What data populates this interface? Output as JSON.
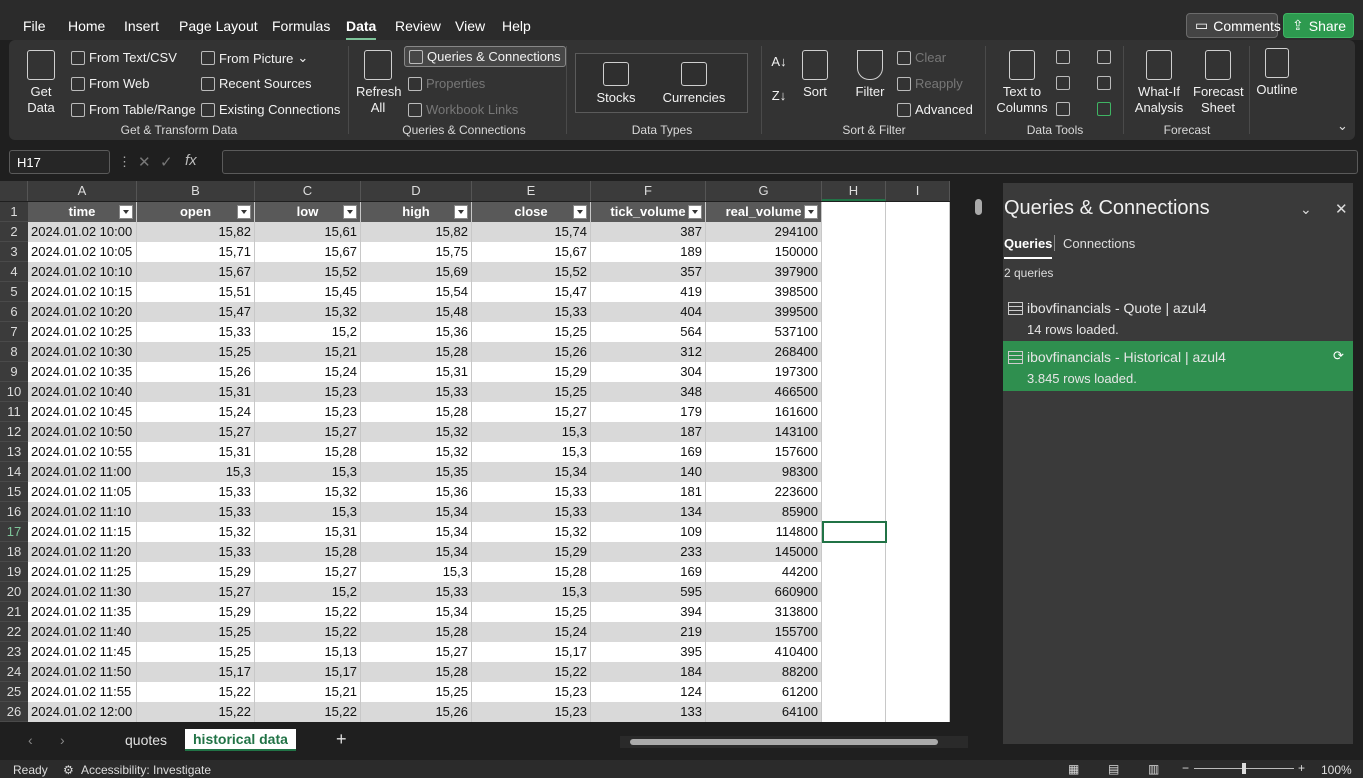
{
  "menu": [
    "File",
    "Home",
    "Insert",
    "Page Layout",
    "Formulas",
    "Data",
    "Review",
    "View",
    "Help"
  ],
  "menu_active": "Data",
  "top_buttons": {
    "comments": "Comments",
    "share": "Share"
  },
  "ribbon": {
    "get_data": [
      "Get",
      "Data"
    ],
    "from_text_csv": "From Text/CSV",
    "from_web": "From Web",
    "from_table_range": "From Table/Range",
    "from_picture": "From Picture",
    "recent_sources": "Recent Sources",
    "existing_connections": "Existing Connections",
    "group_get_transform": "Get & Transform Data",
    "refresh_all": [
      "Refresh",
      "All"
    ],
    "queries_connections": "Queries & Connections",
    "properties": "Properties",
    "workbook_links": "Workbook Links",
    "group_queries": "Queries & Connections",
    "stocks": "Stocks",
    "currencies": "Currencies",
    "group_data_types": "Data Types",
    "sort": "Sort",
    "filter": "Filter",
    "clear": "Clear",
    "reapply": "Reapply",
    "advanced": "Advanced",
    "group_sort_filter": "Sort & Filter",
    "text_to_columns": [
      "Text to",
      "Columns"
    ],
    "group_data_tools": "Data Tools",
    "what_if": [
      "What-If",
      "Analysis"
    ],
    "forecast_sheet": [
      "Forecast",
      "Sheet"
    ],
    "outline": "Outline",
    "group_forecast": "Forecast"
  },
  "name_box": "H17",
  "columns": [
    "A",
    "B",
    "C",
    "D",
    "E",
    "F",
    "G",
    "H",
    "I"
  ],
  "headers": [
    "time",
    "open",
    "low",
    "high",
    "close",
    "tick_volume",
    "real_volume"
  ],
  "rows": [
    [
      "2024.01.02 10:00",
      "15,82",
      "15,61",
      "15,82",
      "15,74",
      "387",
      "294100"
    ],
    [
      "2024.01.02 10:05",
      "15,71",
      "15,67",
      "15,75",
      "15,67",
      "189",
      "150000"
    ],
    [
      "2024.01.02 10:10",
      "15,67",
      "15,52",
      "15,69",
      "15,52",
      "357",
      "397900"
    ],
    [
      "2024.01.02 10:15",
      "15,51",
      "15,45",
      "15,54",
      "15,47",
      "419",
      "398500"
    ],
    [
      "2024.01.02 10:20",
      "15,47",
      "15,32",
      "15,48",
      "15,33",
      "404",
      "399500"
    ],
    [
      "2024.01.02 10:25",
      "15,33",
      "15,2",
      "15,36",
      "15,25",
      "564",
      "537100"
    ],
    [
      "2024.01.02 10:30",
      "15,25",
      "15,21",
      "15,28",
      "15,26",
      "312",
      "268400"
    ],
    [
      "2024.01.02 10:35",
      "15,26",
      "15,24",
      "15,31",
      "15,29",
      "304",
      "197300"
    ],
    [
      "2024.01.02 10:40",
      "15,31",
      "15,23",
      "15,33",
      "15,25",
      "348",
      "466500"
    ],
    [
      "2024.01.02 10:45",
      "15,24",
      "15,23",
      "15,28",
      "15,27",
      "179",
      "161600"
    ],
    [
      "2024.01.02 10:50",
      "15,27",
      "15,27",
      "15,32",
      "15,3",
      "187",
      "143100"
    ],
    [
      "2024.01.02 10:55",
      "15,31",
      "15,28",
      "15,32",
      "15,3",
      "169",
      "157600"
    ],
    [
      "2024.01.02 11:00",
      "15,3",
      "15,3",
      "15,35",
      "15,34",
      "140",
      "98300"
    ],
    [
      "2024.01.02 11:05",
      "15,33",
      "15,32",
      "15,36",
      "15,33",
      "181",
      "223600"
    ],
    [
      "2024.01.02 11:10",
      "15,33",
      "15,3",
      "15,34",
      "15,33",
      "134",
      "85900"
    ],
    [
      "2024.01.02 11:15",
      "15,32",
      "15,31",
      "15,34",
      "15,32",
      "109",
      "114800"
    ],
    [
      "2024.01.02 11:20",
      "15,33",
      "15,28",
      "15,34",
      "15,29",
      "233",
      "145000"
    ],
    [
      "2024.01.02 11:25",
      "15,29",
      "15,27",
      "15,3",
      "15,28",
      "169",
      "44200"
    ],
    [
      "2024.01.02 11:30",
      "15,27",
      "15,2",
      "15,33",
      "15,3",
      "595",
      "660900"
    ],
    [
      "2024.01.02 11:35",
      "15,29",
      "15,22",
      "15,34",
      "15,25",
      "394",
      "313800"
    ],
    [
      "2024.01.02 11:40",
      "15,25",
      "15,22",
      "15,28",
      "15,24",
      "219",
      "155700"
    ],
    [
      "2024.01.02 11:45",
      "15,25",
      "15,13",
      "15,27",
      "15,17",
      "395",
      "410400"
    ],
    [
      "2024.01.02 11:50",
      "15,17",
      "15,17",
      "15,28",
      "15,22",
      "184",
      "88200"
    ],
    [
      "2024.01.02 11:55",
      "15,22",
      "15,21",
      "15,25",
      "15,23",
      "124",
      "61200"
    ],
    [
      "2024.01.02 12:00",
      "15,22",
      "15,22",
      "15,26",
      "15,23",
      "133",
      "64100"
    ]
  ],
  "sheet_tabs": [
    "quotes",
    "historical data"
  ],
  "active_tab": "historical data",
  "pane": {
    "title": "Queries & Connections",
    "tabs": [
      "Queries",
      "Connections"
    ],
    "count": "2 queries",
    "queries": [
      {
        "name": "ibovfinancials - Quote | azul4",
        "status": "14 rows loaded."
      },
      {
        "name": "ibovfinancials - Historical | azul4",
        "status": "3.845 rows loaded."
      }
    ]
  },
  "status": {
    "ready": "Ready",
    "accessibility": "Accessibility: Investigate",
    "zoom": "100%"
  }
}
